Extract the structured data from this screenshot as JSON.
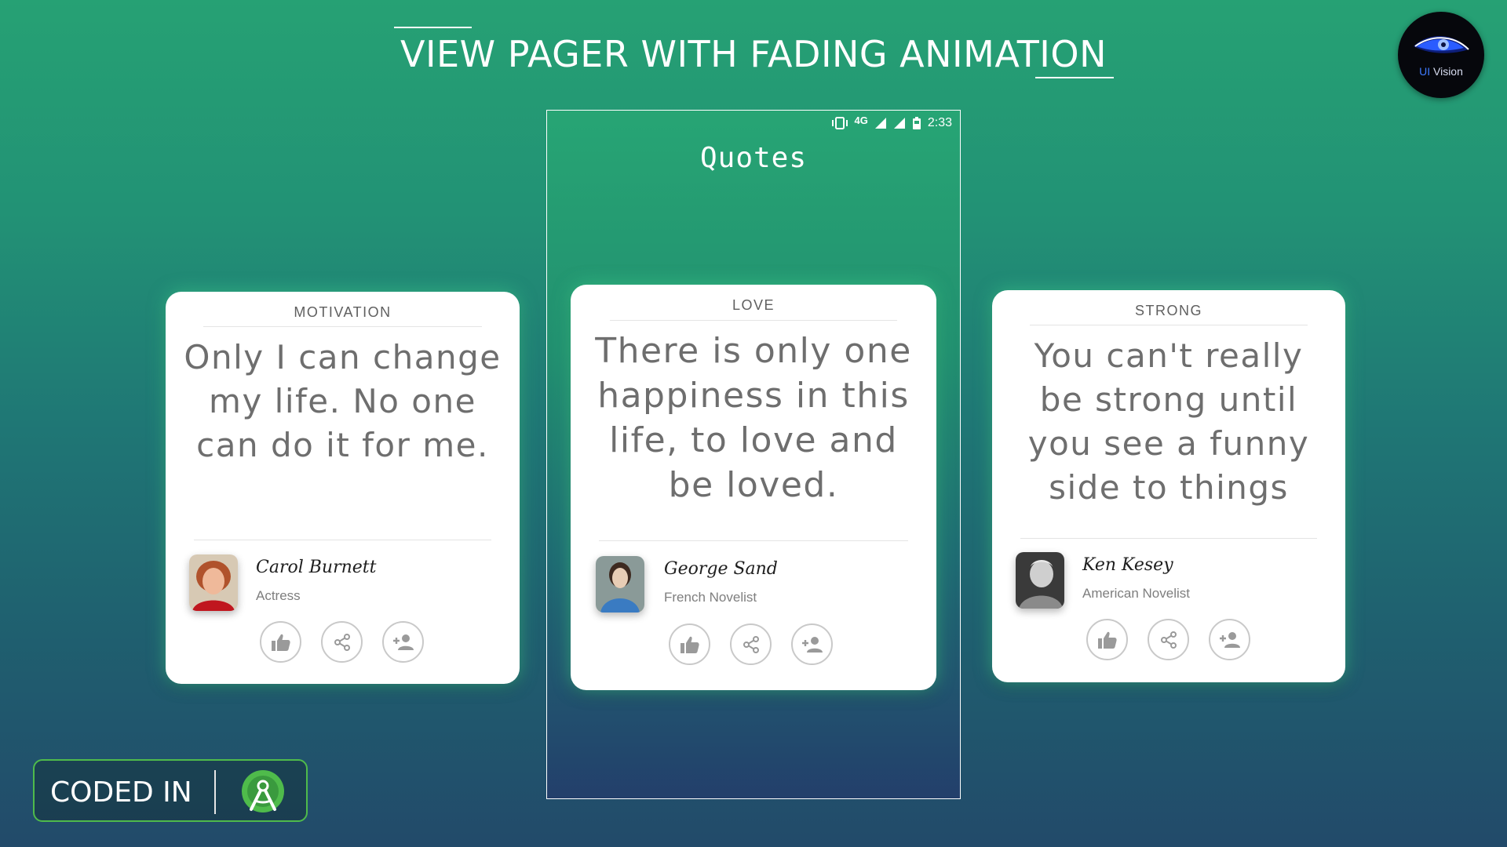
{
  "header": {
    "title": "VIEW PAGER WITH FADING ANIMATION"
  },
  "logo": {
    "text_ui": "UI",
    "text_vision": "Vision"
  },
  "phone": {
    "status": {
      "network": "4G",
      "time": "2:33"
    },
    "app_title": "Quotes"
  },
  "cards": [
    {
      "category": "MOTIVATION",
      "quote": "Only I can change my life. No one can do it for me.",
      "author": "Carol Burnett",
      "role": "Actress"
    },
    {
      "category": "LOVE",
      "quote": "There is only one happiness in this life, to love and be loved.",
      "author": "George Sand",
      "role": "French Novelist"
    },
    {
      "category": "STRONG",
      "quote": "You can't really be strong until you see a funny side to things",
      "author": "Ken Kesey",
      "role": "American Novelist"
    }
  ],
  "badge": {
    "label": "CODED IN"
  },
  "icons": {
    "like": "thumbs-up-icon",
    "share": "share-icon",
    "follow": "add-person-icon"
  }
}
